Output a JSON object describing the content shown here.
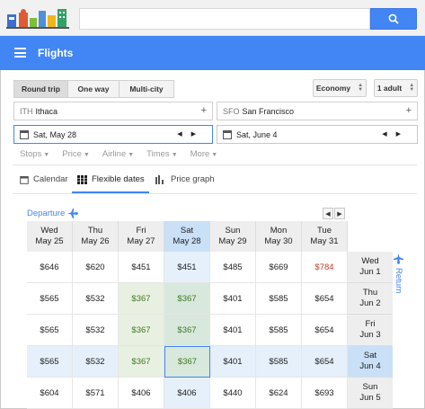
{
  "header": {
    "app_title": "Flights",
    "search": {
      "value": "",
      "placeholder": ""
    }
  },
  "trip_types": [
    {
      "label": "Round trip",
      "selected": true
    },
    {
      "label": "One way"
    },
    {
      "label": "Multi-city"
    }
  ],
  "cabin": {
    "value": "Economy"
  },
  "passengers": {
    "value": "1 adult"
  },
  "origin": {
    "code": "ITH",
    "city": "Ithaca"
  },
  "destination": {
    "code": "SFO",
    "city": "San Francisco"
  },
  "depart_date": "Sat, May 28",
  "return_date": "Sat, June 4",
  "filters": [
    "Stops",
    "Price",
    "Airline",
    "Times",
    "More"
  ],
  "tabs": [
    {
      "label": "Calendar"
    },
    {
      "label": "Flexible dates",
      "selected": true
    },
    {
      "label": "Price graph"
    }
  ],
  "grid": {
    "departure_label": "Departure",
    "return_label": "Return",
    "departure_days": [
      {
        "day": "Wed",
        "date": "May 25"
      },
      {
        "day": "Thu",
        "date": "May 26"
      },
      {
        "day": "Fri",
        "date": "May 27"
      },
      {
        "day": "Sat",
        "date": "May 28"
      },
      {
        "day": "Sun",
        "date": "May 29"
      },
      {
        "day": "Mon",
        "date": "May 30"
      },
      {
        "day": "Tue",
        "date": "May 31"
      }
    ],
    "return_days": [
      {
        "day": "Wed",
        "date": "Jun 1"
      },
      {
        "day": "Thu",
        "date": "Jun 2"
      },
      {
        "day": "Fri",
        "date": "Jun 3"
      },
      {
        "day": "Sat",
        "date": "Jun 4"
      },
      {
        "day": "Sun",
        "date": "Jun 5"
      }
    ],
    "prices": [
      [
        "$646",
        "$620",
        "$451",
        "$451",
        "$485",
        "$669",
        "$784"
      ],
      [
        "$565",
        "$532",
        "$367",
        "$367",
        "$401",
        "$585",
        "$654"
      ],
      [
        "$565",
        "$532",
        "$367",
        "$367",
        "$401",
        "$585",
        "$654"
      ],
      [
        "$565",
        "$532",
        "$367",
        "$367",
        "$401",
        "$585",
        "$654"
      ],
      [
        "$604",
        "$571",
        "$406",
        "$406",
        "$440",
        "$624",
        "$693"
      ]
    ]
  },
  "colors": {
    "accent": "#4285f4",
    "cheapest": "#3f7a1e",
    "expensive": "#c23a2a"
  }
}
